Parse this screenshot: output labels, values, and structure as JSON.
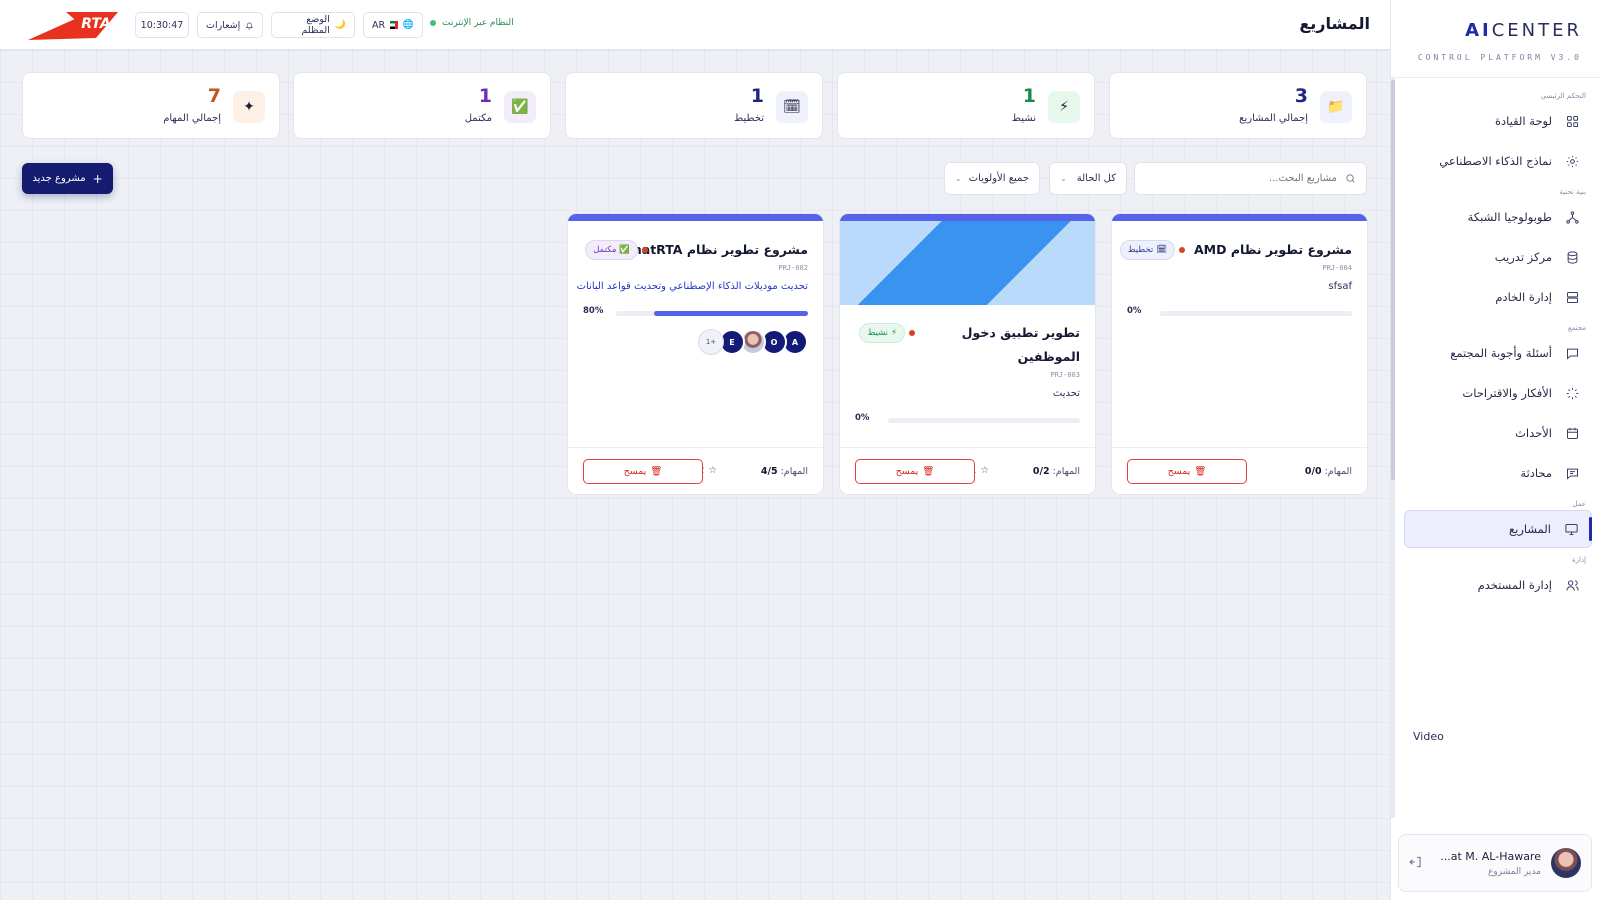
{
  "brand": {
    "title_ai": "AI",
    "title_rest": "CENTER",
    "subtitle": "CONTROL PLATFORM V3.0"
  },
  "header": {
    "page_title": "المشاريع",
    "status_text": "النظام عبر الإنترنت",
    "language": "AR",
    "dark_mode_label": "الوضع المظلم",
    "notifications_label": "إشعارات",
    "time": "10:30:47",
    "logo_text": "RTA",
    "logo_color": "#e8321f"
  },
  "sidebar": {
    "sections": {
      "main": "التحكم الرئيسي",
      "infra": "بنية تحتية",
      "community": "مجتمع",
      "work": "عمل",
      "admin": "إدارة"
    },
    "items": {
      "dashboard": "لوحة القيادة",
      "ai_models": "نماذج الذكاء الاصطناعي",
      "network": "طوبولوجيا الشبكة",
      "training": "مركز تدريب",
      "servers": "إدارة الخادم",
      "qa": "أسئلة وأجوبة المجتمع",
      "ideas": "الأفكار والاقتراحات",
      "events": "الأحداث",
      "chat": "محادثة",
      "projects": "المشاريع",
      "users": "إدارة المستخدم"
    },
    "video_label": "Video",
    "user": {
      "name": "...at M. AL-Haware",
      "role": "مدير المشروع"
    }
  },
  "stats": {
    "total_projects": {
      "value": "3",
      "label": "إجمالي المشاريع",
      "color": "#1f2580"
    },
    "active": {
      "value": "1",
      "label": "نشيط",
      "color": "#1d8a4c"
    },
    "planning": {
      "value": "1",
      "label": "تخطيط",
      "color": "#1f2580"
    },
    "completed": {
      "value": "1",
      "label": "مكتمل",
      "color": "#6d2fb0"
    },
    "total_tasks": {
      "value": "7",
      "label": "إجمالي المهام",
      "color": "#c2571b"
    }
  },
  "filters": {
    "search_placeholder": "مشاريع البحث...",
    "status_select": "كل الحالة",
    "priority_select": "جميع الأولويات",
    "new_project_label": "مشروع جديد"
  },
  "projects": [
    {
      "title": "مشروع تطوير نظام AMD",
      "badge": "تخطيط",
      "id": "PRJ-004",
      "desc": "sfsaf",
      "progress_label": "0%",
      "progress": 0,
      "tasks_label": "المهام:",
      "tasks": "0/0",
      "delete_label": "يمسح"
    },
    {
      "title_line1": "تطوير تطبيق دخول",
      "title_line2": "الموظفين",
      "badge": "نشيط",
      "id": "PRJ-003",
      "desc": "تحديث",
      "progress_label": "0%",
      "progress": 0,
      "tasks_label": "المهام:",
      "tasks": "0/2",
      "stars": "1",
      "delete_label": "يمسح"
    },
    {
      "title": "مشروع تطوير نظام ChatRTA",
      "badge": "مكتمل",
      "id": "PRJ-002",
      "desc": "تحديث موديلات الذكاء الإصطناعي وتحديث قواعد البانات",
      "progress_label": "80%",
      "progress": 80,
      "tasks_label": "المهام:",
      "tasks": "4/5",
      "stars": "2",
      "delete_label": "يمسح",
      "members": [
        "A",
        "O",
        "",
        "E",
        "+1"
      ]
    }
  ]
}
